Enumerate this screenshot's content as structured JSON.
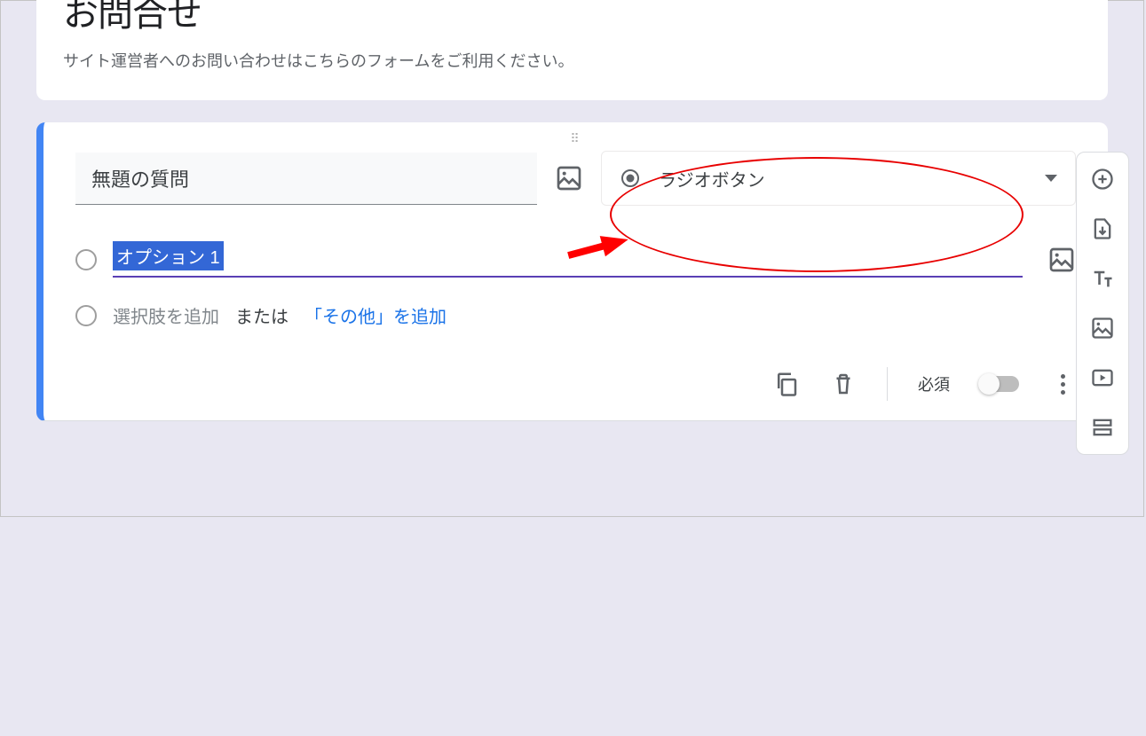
{
  "header": {
    "title": "お問合せ",
    "description": "サイト運営者へのお問い合わせはこちらのフォームをご利用ください。"
  },
  "question": {
    "title": "無題の質問",
    "type_label": "ラジオボタン",
    "option1": "オプション 1",
    "add_option": "選択肢を追加",
    "or": "または",
    "add_other": "「その他」を追加",
    "required_label": "必須"
  },
  "icons": {
    "image": "image-icon",
    "radio": "radio-icon",
    "dropdown": "chevron-down-icon",
    "copy": "copy-icon",
    "delete": "delete-icon",
    "more": "more-icon",
    "add": "add-circle-icon",
    "import": "import-icon",
    "text": "text-icon",
    "img": "insert-image-icon",
    "video": "video-icon",
    "section": "section-icon"
  }
}
